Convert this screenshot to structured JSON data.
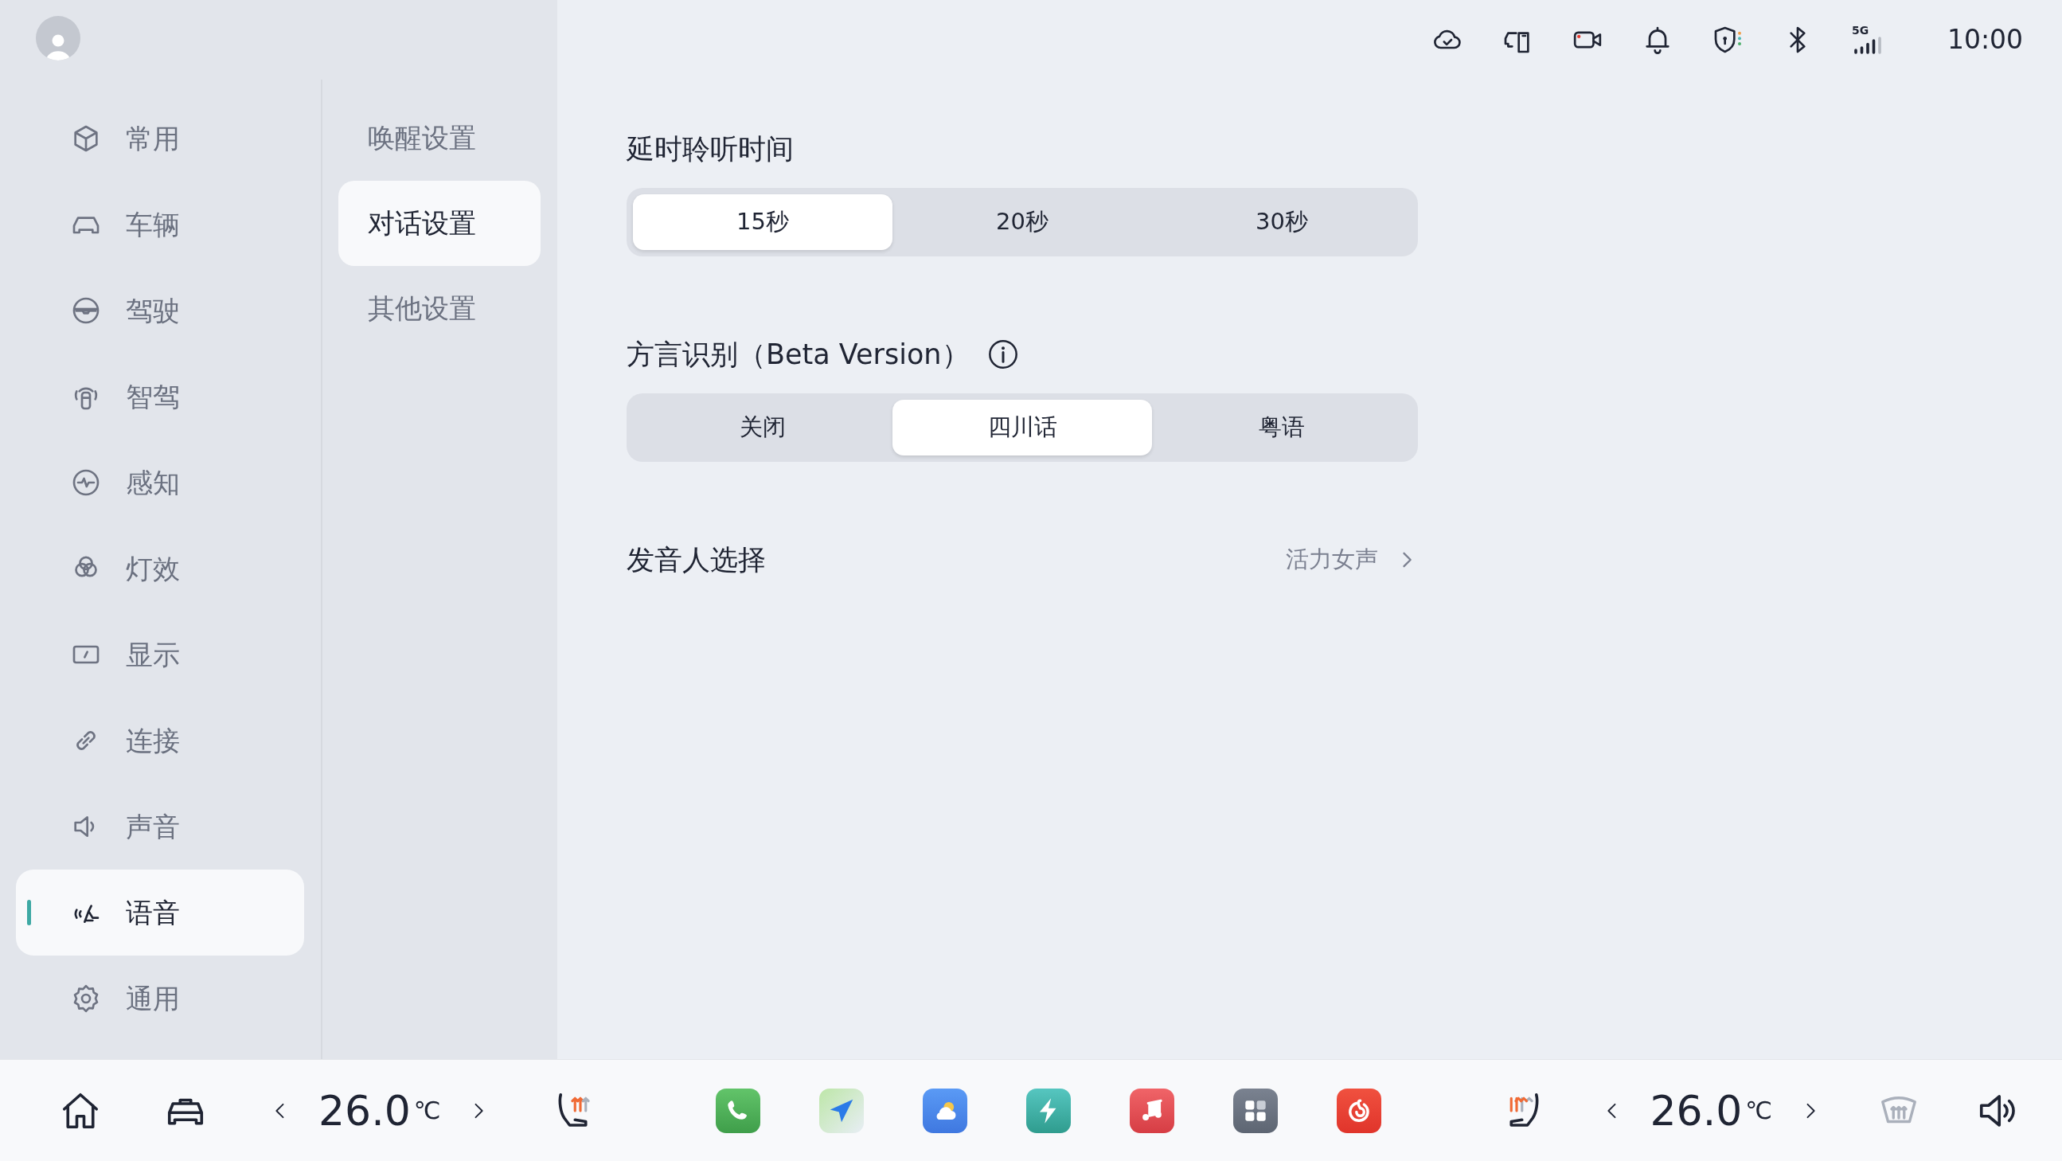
{
  "status_bar": {
    "signal_label": "5G",
    "time": "10:00"
  },
  "sidebar": {
    "items": [
      {
        "label": "常用",
        "kind": "cube",
        "selected": false
      },
      {
        "label": "车辆",
        "kind": "car",
        "selected": false
      },
      {
        "label": "驾驶",
        "kind": "wheel",
        "selected": false
      },
      {
        "label": "智驾",
        "kind": "radar",
        "selected": false
      },
      {
        "label": "感知",
        "kind": "pulse",
        "selected": false
      },
      {
        "label": "灯效",
        "kind": "flower",
        "selected": false
      },
      {
        "label": "显示",
        "kind": "display",
        "selected": false
      },
      {
        "label": "连接",
        "kind": "link",
        "selected": false
      },
      {
        "label": "声音",
        "kind": "speaker",
        "selected": false
      },
      {
        "label": "语音",
        "kind": "voice",
        "selected": true
      },
      {
        "label": "通用",
        "kind": "gear",
        "selected": false
      }
    ]
  },
  "subnav": {
    "items": [
      {
        "label": "唤醒设置",
        "selected": false
      },
      {
        "label": "对话设置",
        "selected": true
      },
      {
        "label": "其他设置",
        "selected": false
      }
    ]
  },
  "sections": [
    {
      "kind": "segmented",
      "title": "延时聆听时间",
      "info": false,
      "options": [
        {
          "label": "15秒",
          "selected": true
        },
        {
          "label": "20秒",
          "selected": false
        },
        {
          "label": "30秒",
          "selected": false
        }
      ]
    },
    {
      "kind": "segmented",
      "title": "方言识别（Beta Version）",
      "info": true,
      "options": [
        {
          "label": "关闭",
          "selected": false
        },
        {
          "label": "四川话",
          "selected": true
        },
        {
          "label": "粤语",
          "selected": false
        }
      ]
    },
    {
      "kind": "link_row",
      "title": "发音人选择",
      "value": "活力女声"
    }
  ],
  "dock": {
    "left_climate": {
      "temperature": "26.0",
      "unit": "℃",
      "seat_heating": true
    },
    "apps": [
      {
        "kind": "phone"
      },
      {
        "kind": "navigation"
      },
      {
        "kind": "weather"
      },
      {
        "kind": "charging"
      },
      {
        "kind": "music"
      },
      {
        "kind": "app_grid"
      },
      {
        "kind": "netease"
      }
    ],
    "right_climate": {
      "temperature": "26.0",
      "unit": "℃",
      "seat_heating": true,
      "defrost": false
    }
  }
}
